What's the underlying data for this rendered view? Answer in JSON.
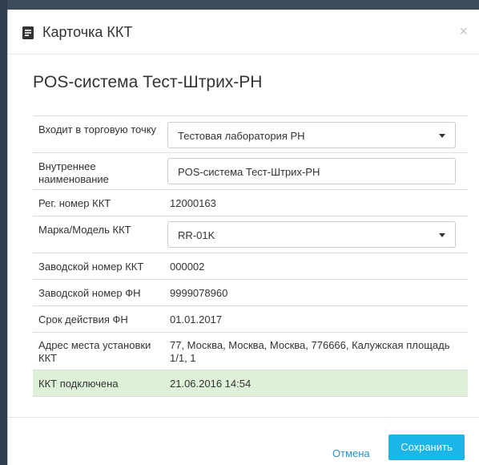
{
  "modal": {
    "title": "Карточка ККТ",
    "close_label": "×",
    "icon": "card-document-icon",
    "heading": "POS-система Тест-Штрих-РН"
  },
  "fields": {
    "store": {
      "label": "Входит в торговую точку",
      "value": "Тестовая лаборатория РН"
    },
    "internal_name": {
      "label": "Внутреннее наименование",
      "value": "POS-система Тест-Штрих-РН"
    },
    "reg_number": {
      "label": "Рег. номер ККТ",
      "value": "12000163"
    },
    "model": {
      "label": "Марка/Модель ККТ",
      "value": "RR-01K"
    },
    "serial_kkt": {
      "label": "Заводской номер ККТ",
      "value": "000002"
    },
    "serial_fn": {
      "label": "Заводской номер ФН",
      "value": "9999078960"
    },
    "fn_expiry": {
      "label": "Срок действия ФН",
      "value": "01.01.2017"
    },
    "address": {
      "label": "Адрес места установки ККТ",
      "value": "77, Москва, Москва, Москва, 776666, Калужская площадь 1/1, 1"
    },
    "connected": {
      "label": "ККТ подключена",
      "value": "21.06.2016 14:54"
    }
  },
  "footer": {
    "cancel_label": "Отмена",
    "save_label": "Сохранить"
  },
  "colors": {
    "accent": "#1bb5e8",
    "link": "#2a8fd4",
    "connected_row": "#dff0d8"
  }
}
